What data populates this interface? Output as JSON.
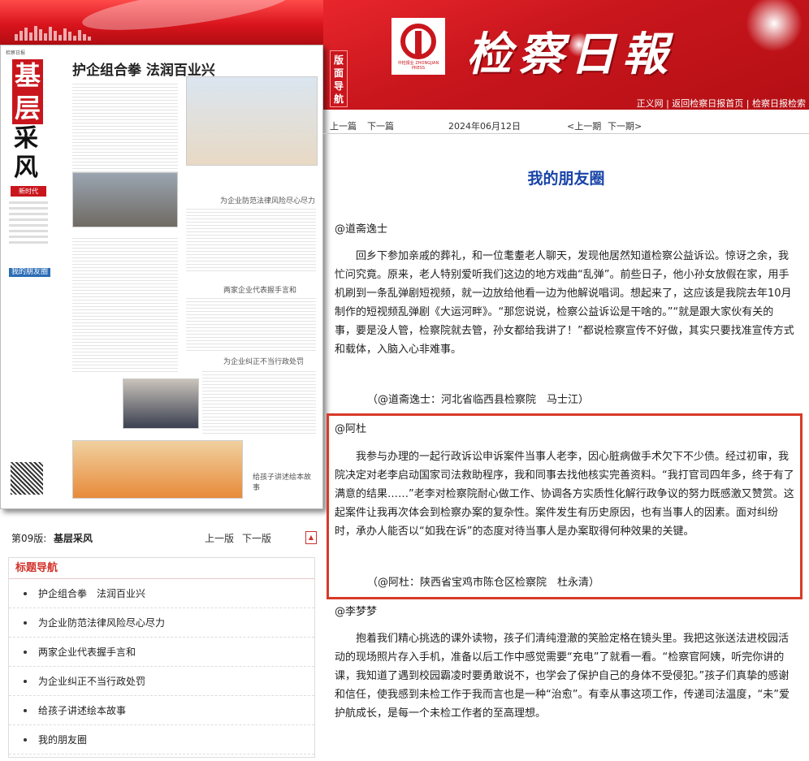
{
  "masthead": {
    "guide_label": "版面导航",
    "logo_press": "中检报业 ZHONGJIAN PRESS",
    "title": "检察日報",
    "links": "正义网 | 返回检察日报首页 | 检察日报检索"
  },
  "article_nav": {
    "prev_article": "上一篇",
    "next_article": "下一篇",
    "date": "2024年06月12日",
    "prev_issue": "<上一期",
    "next_issue": "下一期>"
  },
  "newspaper_thumb": {
    "brand": "检察日报",
    "section_red": "基层",
    "section_black": "采风",
    "edition": "新时代",
    "friend_label": "我的朋友圈",
    "headline": "护企组合拳 法润百业兴",
    "sub1": "为企业防范法律风险尽心尽力",
    "sub2": "两家企业代表握手言和",
    "sub3": "为企业纠正不当行政处罚",
    "sub4": "给孩子讲述绘本故事"
  },
  "page_info": {
    "label": "第09版:",
    "name": "基层采风",
    "prev": "上一版",
    "next": "下一版",
    "pdf_icon": "pdf-icon"
  },
  "nav": {
    "title": "标题导航",
    "items": [
      "护企组合拳　法润百业兴",
      "为企业防范法律风险尽心尽力",
      "两家企业代表握手言和",
      "为企业纠正不当行政处罚",
      "给孩子讲述绘本故事",
      "我的朋友圈"
    ]
  },
  "article": {
    "title": "我的朋友圈",
    "sections": [
      {
        "author": "@道斋逸士",
        "text": "回乡下参加亲戚的葬礼，和一位耄耋老人聊天，发现他居然知道检察公益诉讼。惊讶之余，我忙问究竟。原来，老人特别爱听我们这边的地方戏曲“乱弹”。前些日子，他小孙女放假在家，用手机刷到一条乱弹剧短视频，就一边放给他看一边为他解说唱词。想起来了，这应该是我院去年10月制作的短视频乱弹剧《大运河畔》。“那您说说，检察公益诉讼是干啥的。”“就是跟大家伙有关的事，要是没人管，检察院就去管，孙女都给我讲了！”都说检察宣传不好做，其实只要找准宣传方式和载体，入脑入心非难事。",
        "sign": "（@道斋逸士：河北省临西县检察院　马士江）"
      },
      {
        "author": "@阿杜",
        "text": "我参与办理的一起行政诉讼申诉案件当事人老李，因心脏病做手术欠下不少债。经过初审，我院决定对老李启动国家司法救助程序，我和同事去找他核实完善资料。“我打官司四年多，终于有了满意的结果……”老李对检察院耐心做工作、协调各方实质性化解行政争议的努力既感激又赞赏。这起案件让我再次体会到检察办案的复杂性。案件发生有历史原因，也有当事人的因素。面对纠纷时，承办人能否以“如我在诉”的态度对待当事人是办案取得何种效果的关键。",
        "sign": "（@阿杜：陕西省宝鸡市陈仓区检察院　杜永清）"
      },
      {
        "author": "@李梦梦",
        "text": "抱着我们精心挑选的课外读物，孩子们清纯澄澈的笑脸定格在镜头里。我把这张送法进校园活动的现场照片存入手机，准备以后工作中感觉需要“充电”了就看一看。“检察官阿姨，听完你讲的课，我知道了遇到校园霸凌时要勇敢说不，也学会了保护自己的身体不受侵犯。”孩子们真挚的感谢和信任，使我感到未检工作于我而言也是一种“治愈”。有幸从事这项工作，传递司法温度，“未”爱护航成长，是每一个未检工作者的至高理想。"
      }
    ]
  },
  "colors": {
    "brand_red": "#c9161d",
    "title_blue": "#1844a8",
    "highlight_border": "#d83a28",
    "nav_title": "#d2322a"
  }
}
